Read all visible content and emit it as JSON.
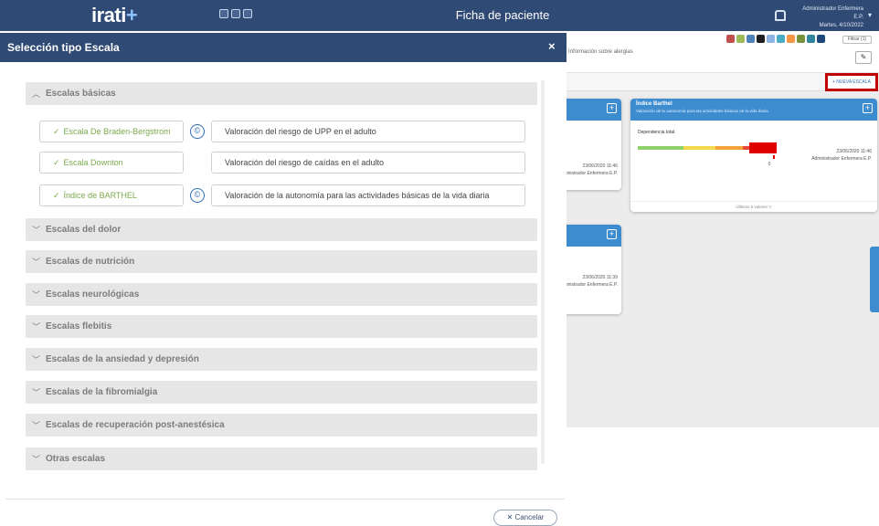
{
  "app": {
    "brand": "irati",
    "brand_plus": "+",
    "title": "Ficha de paciente",
    "user_line1": "Administrador Enfermera E.P.",
    "user_line2": "Martes, 4/10/2022"
  },
  "background": {
    "info_text": "Información sobre alergias",
    "filter_label": "Filtrar (1)",
    "new_scale_button": "+ NUEVA ESCALA",
    "barthel_card": {
      "title": "Índice Barthel",
      "subtitle": "Valoración de la autonomía para las actividades básicas de la vida diaria",
      "label": "Dependencia total",
      "value": "0",
      "date": "23/06/2020 11:46",
      "author": "Administrador Enfermera E.P.",
      "footer": "Últimos 5 valores ▽"
    },
    "left_card_1": {
      "date": "23/06/2020 11:46",
      "author": "Administrador Enfermera E.P."
    },
    "left_card_2": {
      "date": "23/06/2020 11:39",
      "author": "Administrador Enfermera E.P."
    }
  },
  "modal": {
    "title": "Selección tipo Escala",
    "close_icon": "×",
    "categories": [
      {
        "label": "Escalas básicas",
        "expanded": true
      },
      {
        "label": "Escalas del dolor",
        "expanded": false
      },
      {
        "label": "Escalas de nutrición",
        "expanded": false
      },
      {
        "label": "Escalas neurológicas",
        "expanded": false
      },
      {
        "label": "Escalas flebitis",
        "expanded": false
      },
      {
        "label": "Escalas de la ansiedad y depresión",
        "expanded": false
      },
      {
        "label": "Escalas de la fibromialgia",
        "expanded": false
      },
      {
        "label": "Escalas de recuperación post-anestésica",
        "expanded": false
      },
      {
        "label": "Otras escalas",
        "expanded": false
      }
    ],
    "scales": [
      {
        "name": "Escala De Braden-Bergstrom",
        "has_info": true,
        "description": "Valoración del riesgo de UPP en el adulto"
      },
      {
        "name": "Escala Downton",
        "has_info": false,
        "description": "Valoración del riesgo de caídas en el adulto"
      },
      {
        "name": "Índice de BARTHEL",
        "has_info": true,
        "description": "Valoración de la autonomía para las actividades básicas de la vida diaria"
      }
    ],
    "cancel_button": "Cancelar"
  },
  "colors": {
    "header": "#2f4a74",
    "accent_blue": "#3d8ccf",
    "scale_green": "#7aaa4c",
    "highlight_red": "#c00000"
  },
  "icons": {
    "expanded": "chevron-up-icon",
    "collapsed": "chevron-down-icon",
    "check": "check-icon",
    "info": "info-icon",
    "close": "close-icon"
  }
}
